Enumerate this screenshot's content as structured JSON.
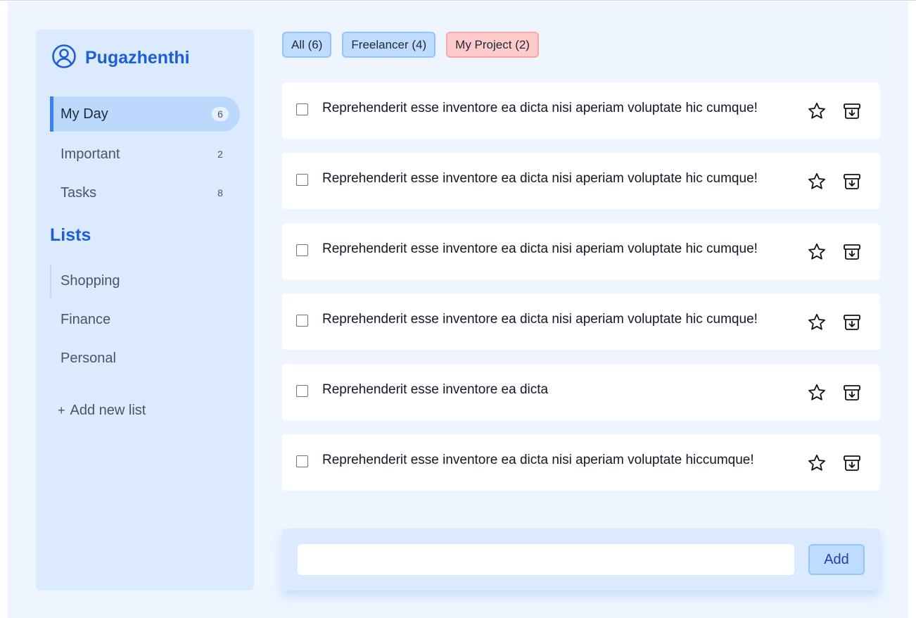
{
  "user": {
    "name": "Pugazhenthi",
    "icon": "user-circle-icon"
  },
  "nav": [
    {
      "label": "My Day",
      "count": "6",
      "active": true
    },
    {
      "label": "Important",
      "count": "2"
    },
    {
      "label": "Tasks",
      "count": "8"
    }
  ],
  "lists": {
    "heading": "Lists",
    "items": [
      "Shopping",
      "Finance",
      "Personal"
    ],
    "add_plus": "+",
    "add_label": "Add new list"
  },
  "filters": [
    "All (6)",
    "Freelancer (4)",
    "My Project (2)"
  ],
  "tasks": [
    {
      "text": "Reprehenderit esse inventore ea dicta nisi aperiam voluptate hic cumque!"
    },
    {
      "text": "Reprehenderit esse inventore ea dicta nisi aperiam voluptate hic cumque!"
    },
    {
      "text": "Reprehenderit esse inventore ea dicta nisi aperiam voluptate hic cumque!"
    },
    {
      "text": "Reprehenderit esse inventore ea dicta nisi aperiam voluptate hic cumque!"
    },
    {
      "text": "Reprehenderit esse inventore ea dicta"
    },
    {
      "text": "Reprehenderit esse inventore ea dicta nisi aperiam voluptate hiccumque!"
    }
  ],
  "task_icons": {
    "star": "star-icon",
    "archive": "archive-icon"
  },
  "add_bar": {
    "input_value": "",
    "button_label": "Add"
  },
  "colors": {
    "accent": "#1d5fd6",
    "sidebar_bg": "#dbeafe",
    "page_bg": "#eef5ff",
    "chip_blue": "#bfdbfe",
    "chip_red": "#fecaca",
    "active_bar": "#3b82f6"
  }
}
